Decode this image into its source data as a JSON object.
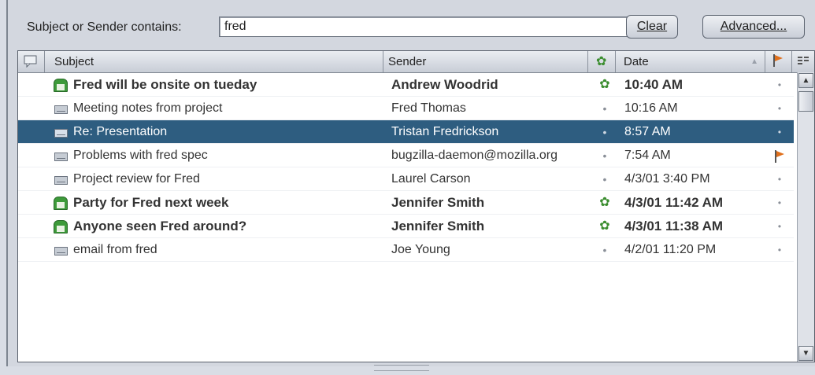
{
  "search": {
    "label": "Subject or Sender contains:",
    "value": "fred",
    "clear_label": "Clear",
    "advanced_label": "Advanced..."
  },
  "columns": {
    "subject": "Subject",
    "sender": "Sender",
    "date": "Date",
    "sort_indicator": "▲"
  },
  "messages": [
    {
      "subject": "Fred will be onsite on tueday",
      "sender": "Andrew Woodrid",
      "date": "10:40 AM",
      "unread": true,
      "selected": false,
      "flagged": false
    },
    {
      "subject": "Meeting notes from project",
      "sender": "Fred Thomas",
      "date": "10:16 AM",
      "unread": false,
      "selected": false,
      "flagged": false
    },
    {
      "subject": "Re: Presentation",
      "sender": "Tristan Fredrickson",
      "date": "8:57 AM",
      "unread": false,
      "selected": true,
      "flagged": false
    },
    {
      "subject": "Problems with fred spec",
      "sender": "bugzilla-daemon@mozilla.org",
      "date": "7:54 AM",
      "unread": false,
      "selected": false,
      "flagged": true
    },
    {
      "subject": "Project review for Fred",
      "sender": "Laurel Carson",
      "date": "4/3/01 3:40 PM",
      "unread": false,
      "selected": false,
      "flagged": false
    },
    {
      "subject": "Party for Fred next week",
      "sender": "Jennifer Smith",
      "date": "4/3/01 11:42 AM",
      "unread": true,
      "selected": false,
      "flagged": false
    },
    {
      "subject": "Anyone seen Fred around?",
      "sender": "Jennifer Smith",
      "date": "4/3/01 11:38 AM",
      "unread": true,
      "selected": false,
      "flagged": false
    },
    {
      "subject": "email from fred",
      "sender": "Joe Young",
      "date": "4/2/01 11:20 PM",
      "unread": false,
      "selected": false,
      "flagged": false
    }
  ],
  "colors": {
    "selection": "#2e5d80",
    "unread_dot": "#3b8d2f",
    "flag": "#e0701c"
  }
}
